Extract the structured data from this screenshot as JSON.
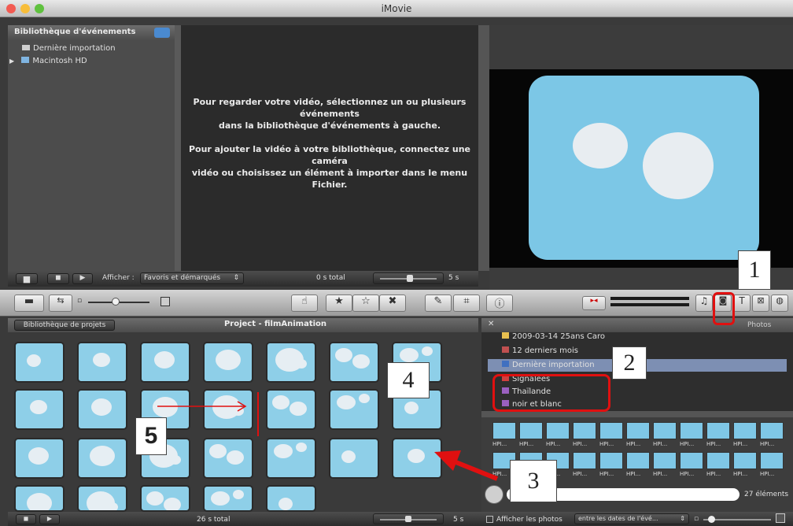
{
  "window": {
    "title": "iMovie"
  },
  "event_library": {
    "header": "Bibliothèque d'événements",
    "items": [
      {
        "label": "Dernière importation"
      },
      {
        "label": "Macintosh HD"
      }
    ]
  },
  "viewer_message": {
    "line1": "Pour regarder votre vidéo, sélectionnez un ou plusieurs événements",
    "line2": "dans la bibliothèque d'événements à gauche.",
    "line3": "Pour ajouter la vidéo à votre bibliothèque, connectez une caméra",
    "line4": "vidéo ou choisissez un élément à importer dans le menu Fichier."
  },
  "event_bar": {
    "show_label": "Afficher :",
    "show_value": "Favoris et démarqués",
    "total": "0 s total",
    "zoom_value": "5 s"
  },
  "project": {
    "library_button": "Bibliothèque de projets",
    "title": "Project - filmAnimation",
    "total": "26 s total",
    "zoom_value": "5 s"
  },
  "photos": {
    "header": "Photos",
    "list": [
      {
        "label": "2009-03-14 25ans Caro"
      },
      {
        "label": "12 derniers mois"
      },
      {
        "label": "Dernière importation"
      },
      {
        "label": "Signalées"
      },
      {
        "label": "Thaïlande"
      },
      {
        "label": "noir et blanc"
      }
    ],
    "thumb_label": "HPI...",
    "count": "27 éléments",
    "show_photos_label": "Afficher les photos",
    "date_filter": "entre les dates de l'évé..."
  },
  "annotations": {
    "n1": "1",
    "n2": "2",
    "n3": "3",
    "n4": "4",
    "n5": "5"
  },
  "colors": {
    "accent_red": "#e01010",
    "sky_blue": "#8ecfe8"
  }
}
